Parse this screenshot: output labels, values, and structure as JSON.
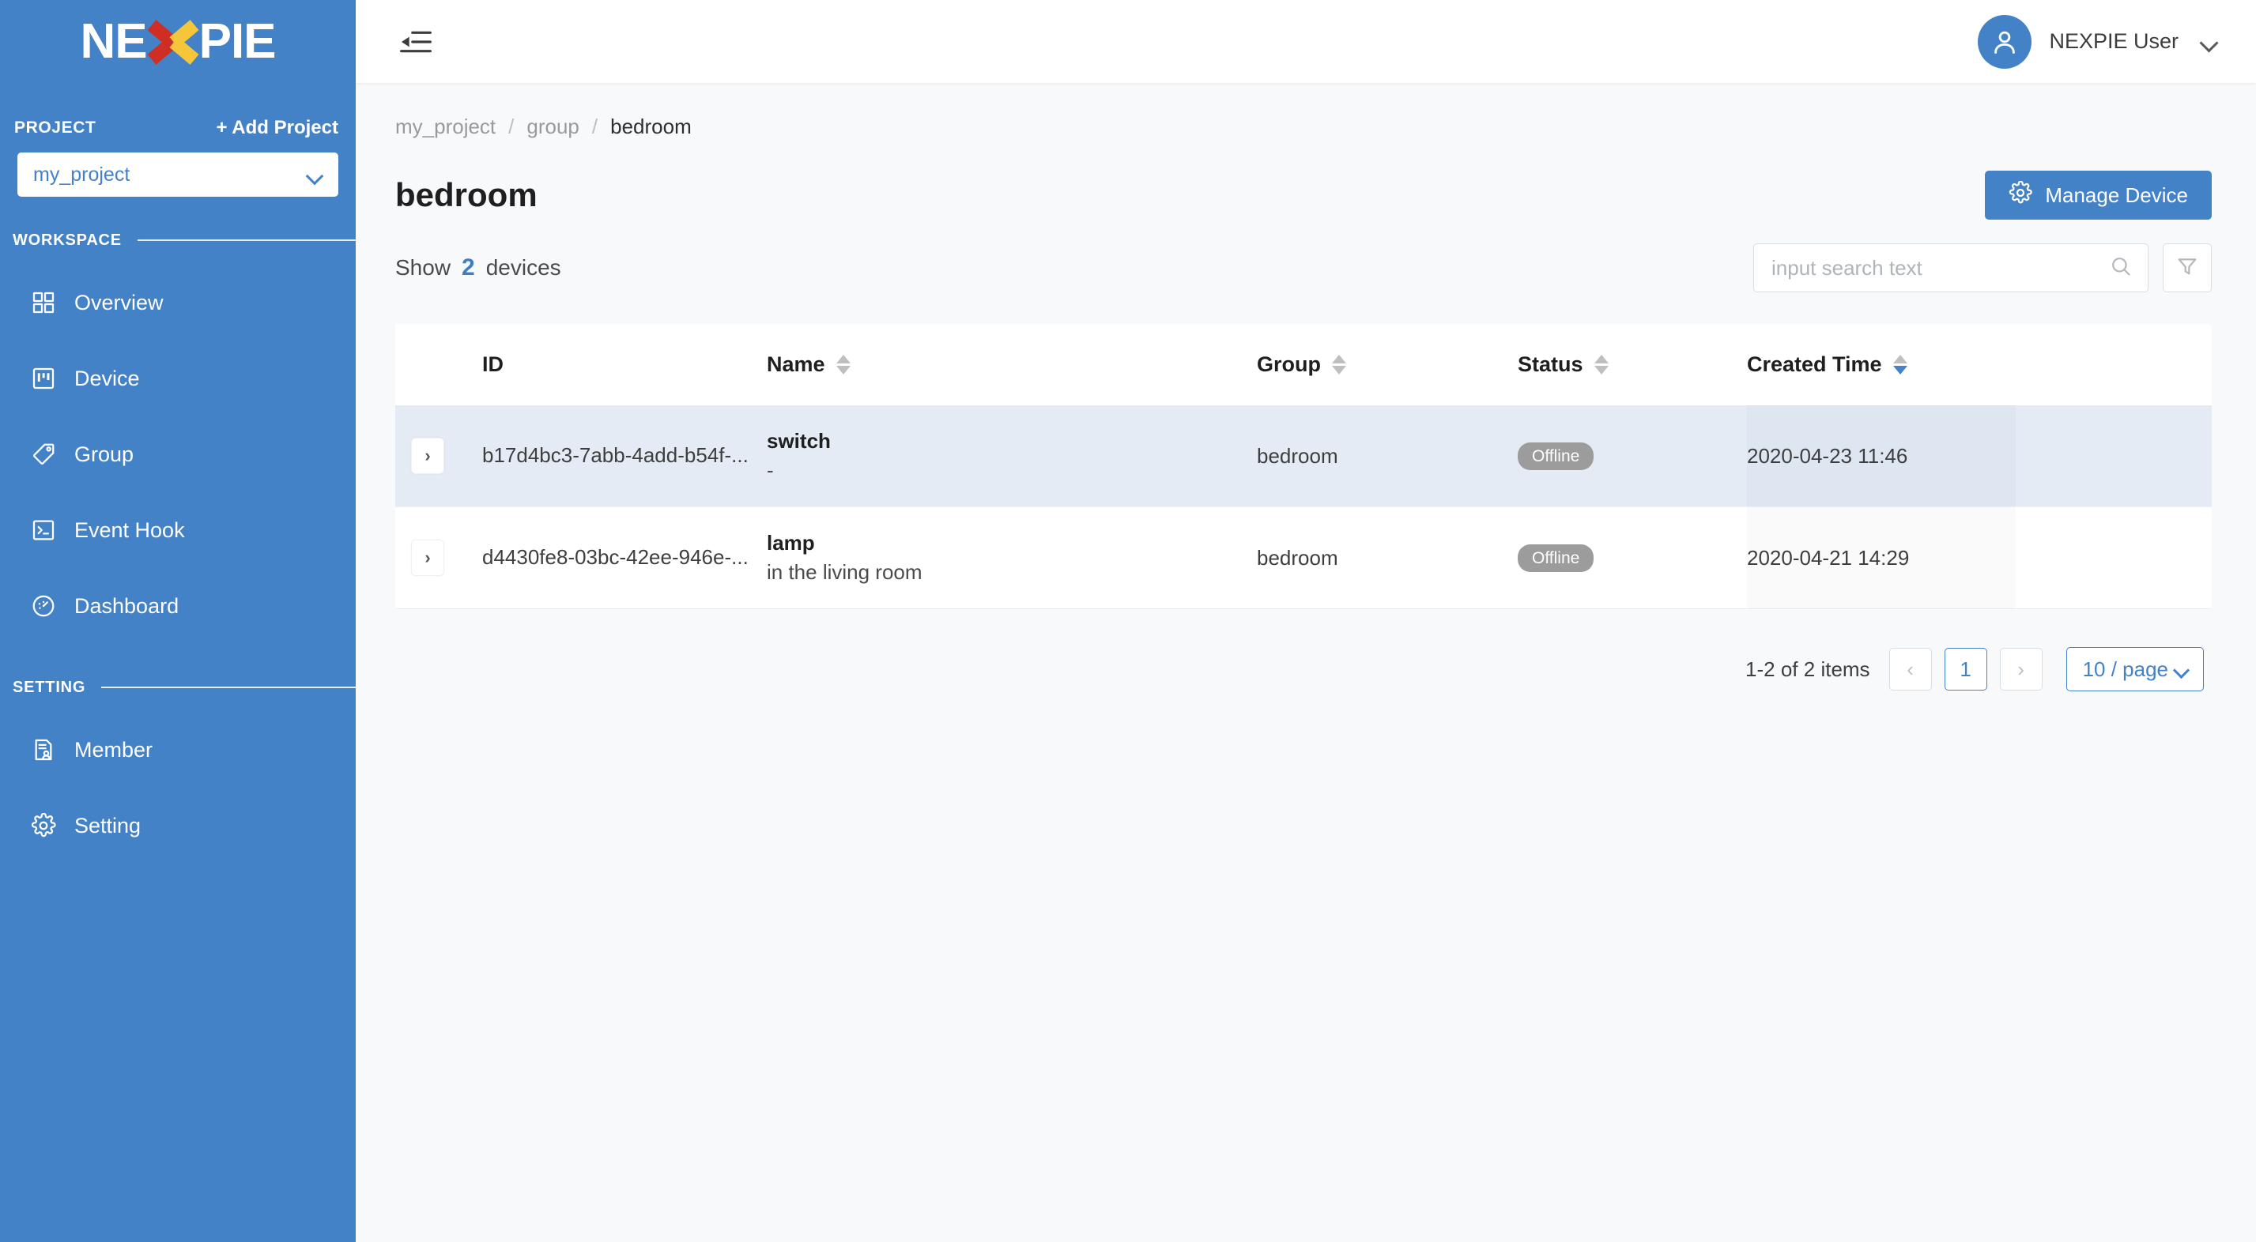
{
  "brand": {
    "logo_text_1": "NE",
    "logo_x": "X",
    "logo_text_2": "PIE"
  },
  "sidebar": {
    "project_label": "PROJECT",
    "add_project_label": "+ Add Project",
    "project_selected": "my_project",
    "sections": [
      {
        "title": "WORKSPACE"
      },
      {
        "title": "SETTING"
      }
    ],
    "workspace_items": [
      {
        "label": "Overview",
        "icon": "appstore-icon"
      },
      {
        "label": "Device",
        "icon": "project-window-icon"
      },
      {
        "label": "Group",
        "icon": "tag-icon"
      },
      {
        "label": "Event Hook",
        "icon": "code-console-icon"
      },
      {
        "label": "Dashboard",
        "icon": "dashboard-gauge-icon"
      }
    ],
    "setting_items": [
      {
        "label": "Member",
        "icon": "solution-person-icon"
      },
      {
        "label": "Setting",
        "icon": "gear-icon"
      }
    ]
  },
  "topbar": {
    "fold_icon": "menu-fold-icon",
    "user_name": "NEXPIE User",
    "avatar_icon": "user-avatar-icon",
    "caret_icon": "chevron-down-icon"
  },
  "breadcrumb": [
    {
      "label": "my_project",
      "active": false
    },
    {
      "label": "group",
      "active": false
    },
    {
      "label": "bedroom",
      "active": true
    }
  ],
  "page": {
    "title": "bedroom",
    "manage_button": "Manage Device",
    "manage_button_icon": "gear-icon",
    "show_prefix": "Show",
    "show_count": "2",
    "show_suffix": "devices"
  },
  "search": {
    "placeholder": "input search text",
    "value": "",
    "search_icon": "search-icon",
    "filter_icon": "filter-funnel-icon"
  },
  "table": {
    "columns": [
      {
        "key": "expand",
        "label": "",
        "sortable": false
      },
      {
        "key": "id",
        "label": "ID",
        "sortable": false
      },
      {
        "key": "name",
        "label": "Name",
        "sortable": true,
        "sort": "none"
      },
      {
        "key": "group",
        "label": "Group",
        "sortable": true,
        "sort": "none"
      },
      {
        "key": "status",
        "label": "Status",
        "sortable": true,
        "sort": "none"
      },
      {
        "key": "created_time",
        "label": "Created Time",
        "sortable": true,
        "sort": "desc"
      }
    ],
    "rows": [
      {
        "id": "b17d4bc3-7abb-4add-b54f-...",
        "name": "switch",
        "description": "-",
        "group": "bedroom",
        "status": "Offline",
        "created_time": "2020-04-23 11:46",
        "selected": true
      },
      {
        "id": "d4430fe8-03bc-42ee-946e-...",
        "name": "lamp",
        "description": "in the living room",
        "group": "bedroom",
        "status": "Offline",
        "created_time": "2020-04-21 14:29",
        "selected": false
      }
    ]
  },
  "pagination": {
    "total_text": "1-2 of 2 items",
    "prev_label": "‹",
    "next_label": "›",
    "current_page": "1",
    "page_size": "10 / page"
  },
  "colors": {
    "brand_blue": "#4482C8",
    "logo_red": "#CE2E24",
    "logo_yellow": "#F5C63A",
    "row_selected": "#E4EBF5",
    "status_badge": "#9C9C9C",
    "content_bg": "#F7F9FB"
  }
}
